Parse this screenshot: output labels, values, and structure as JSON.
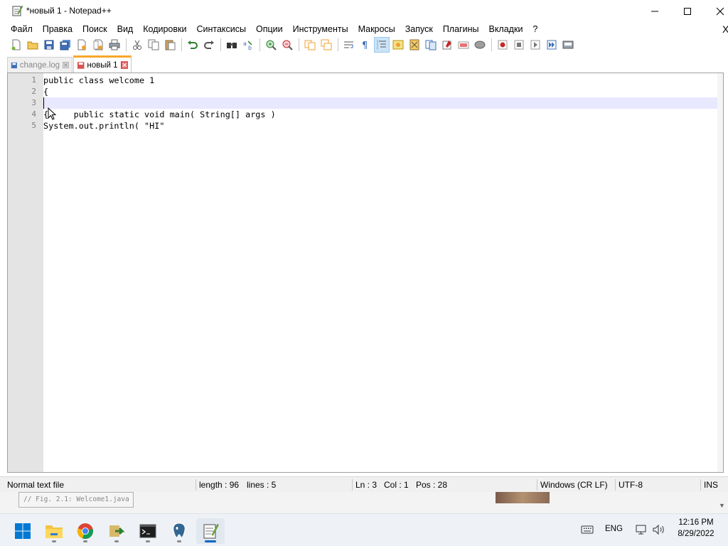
{
  "window": {
    "title": "*новый 1 - Notepad++"
  },
  "menu": {
    "items": [
      "Файл",
      "Правка",
      "Поиск",
      "Вид",
      "Кодировки",
      "Синтаксисы",
      "Опции",
      "Инструменты",
      "Макросы",
      "Запуск",
      "Плагины",
      "Вкладки",
      "?"
    ],
    "close_glyph": "X"
  },
  "toolbar": {
    "icons": [
      "new-file-icon",
      "open-file-icon",
      "save-icon",
      "save-all-icon",
      "close-icon",
      "close-all-icon",
      "print-icon",
      "cut-icon",
      "copy-icon",
      "paste-icon",
      "undo-icon",
      "redo-icon",
      "find-icon",
      "replace-icon",
      "zoom-in-icon",
      "zoom-out-icon",
      "sync-vertical-icon",
      "sync-horizontal-icon",
      "word-wrap-icon",
      "show-all-chars-icon",
      "indent-guide-icon",
      "udl-icon",
      "doc-map-icon",
      "function-list-icon",
      "folder-workspace-icon",
      "monitoring-icon",
      "record-macro-icon",
      "stop-macro-icon",
      "play-macro-icon",
      "run-macro-multiple-icon",
      "save-macro-icon"
    ]
  },
  "tabs": [
    {
      "label": "change.log",
      "active": false
    },
    {
      "label": "новый 1",
      "active": true
    }
  ],
  "editor": {
    "lines": [
      {
        "num": "1",
        "text": "public class welcome 1"
      },
      {
        "num": "2",
        "text": "{"
      },
      {
        "num": "3",
        "text": "public static void main( String[] args )"
      },
      {
        "num": "4",
        "text": "{"
      },
      {
        "num": "5",
        "text": "System.out.println( \"HI\""
      }
    ],
    "current_line": 3
  },
  "status": {
    "file_type": "Normal text file",
    "length": "length : 96",
    "lines": "lines : 5",
    "ln": "Ln : 3",
    "col": "Col : 1",
    "pos": "Pos : 28",
    "eol": "Windows (CR LF)",
    "encoding": "UTF-8",
    "mode": "INS"
  },
  "background_window": {
    "code_snippet": "// Fig. 2.1: Welcome1.java"
  },
  "taskbar": {
    "apps": [
      "start-icon",
      "file-explorer-icon",
      "chrome-icon",
      "app-arrow-icon",
      "terminal-icon",
      "postgres-icon",
      "notepadpp-icon"
    ],
    "language": "ENG",
    "time": "12:16 PM",
    "date": "8/29/2022"
  },
  "colors": {
    "tab_accent": "#f9a72b",
    "current_line": "#e8e8ff",
    "gutter": "#e4e4e4",
    "taskbar_accent": "#0067c0"
  }
}
